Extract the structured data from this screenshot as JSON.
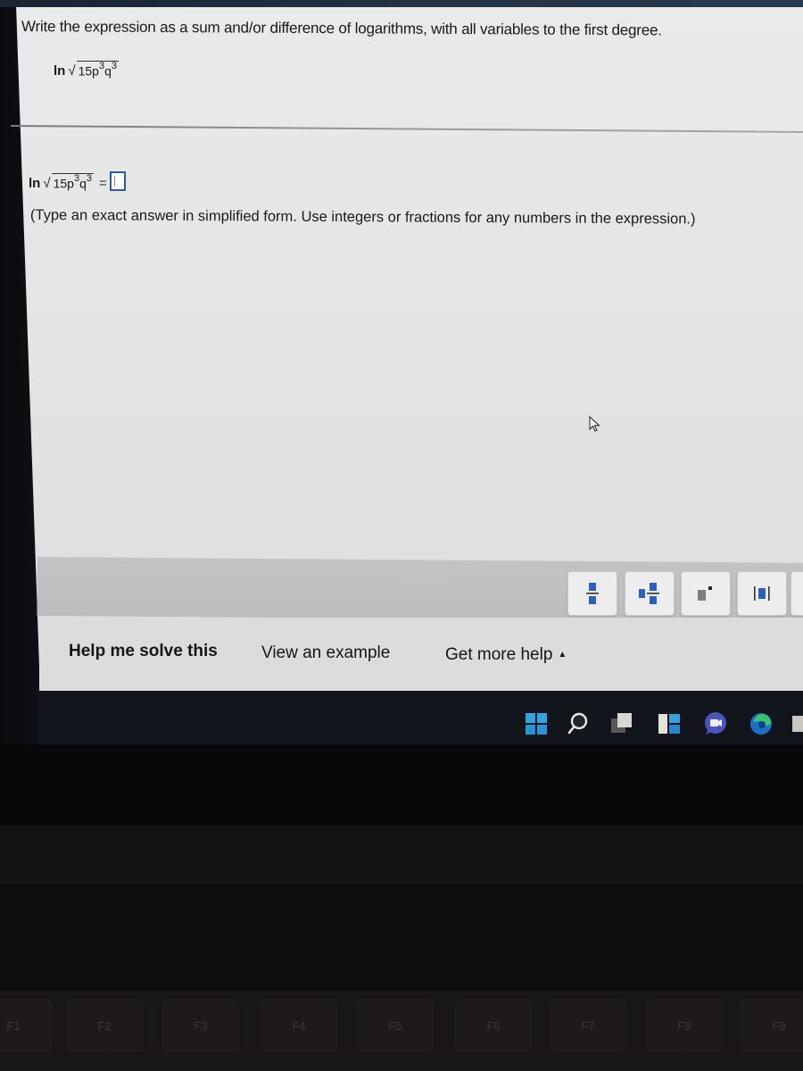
{
  "question": {
    "prompt": "Write the expression as a sum and/or difference of logarithms, with all variables to the first degree.",
    "expression": {
      "func": "ln",
      "radical": "√",
      "coefficient": "15",
      "var1": "p",
      "exp1": "3",
      "var2": "q",
      "exp2": "3"
    }
  },
  "answer": {
    "equals": "=",
    "value": "",
    "instruction": "(Type an exact answer in simplified form. Use integers or fractions for any numbers in the expression.)"
  },
  "palette": {
    "buttons": [
      {
        "name": "fraction",
        "icon": "fraction-icon"
      },
      {
        "name": "mixed-number",
        "icon": "mixed-number-icon"
      },
      {
        "name": "exponent",
        "icon": "exponent-icon"
      },
      {
        "name": "absolute-value",
        "icon": "absolute-value-icon"
      }
    ],
    "accent_color": "#2e5fbf"
  },
  "help": {
    "help_me_solve": "Help me solve this",
    "view_example": "View an example",
    "get_more_help": "Get more help",
    "get_more_help_caret": "▲"
  },
  "taskbar": {
    "icons": [
      "windows-start-icon",
      "search-icon",
      "task-view-icon",
      "widgets-icon",
      "teams-chat-icon",
      "edge-browser-icon",
      "file-explorer-icon"
    ]
  },
  "keyboard": {
    "keys": [
      "F1",
      "F2",
      "F3",
      "F4",
      "F5",
      "F6",
      "F7",
      "F8",
      "F9"
    ]
  }
}
